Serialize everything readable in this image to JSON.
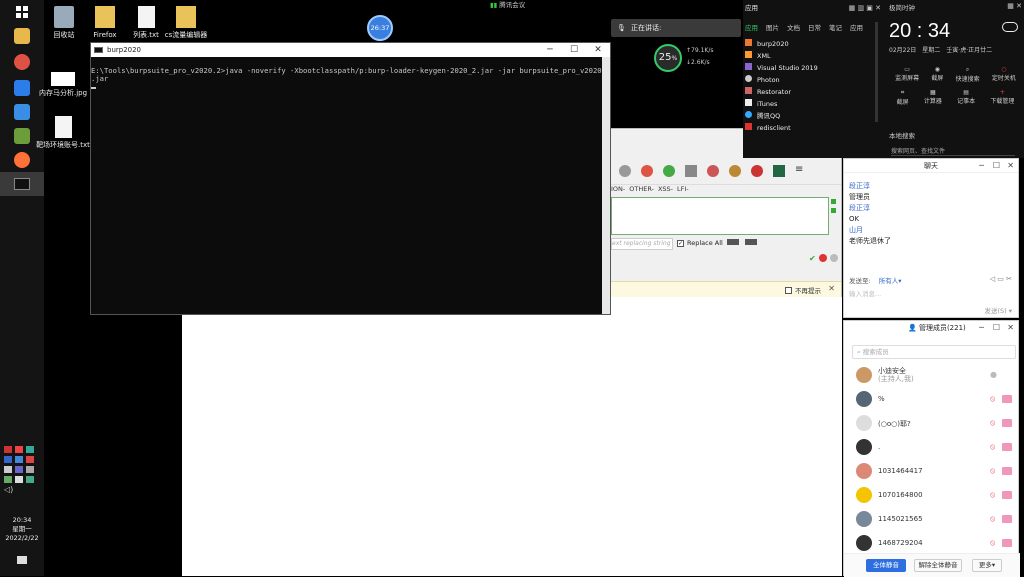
{
  "taskbar": {
    "clock_time": "20:34",
    "clock_day": "星期一",
    "clock_date": "2022/2/22"
  },
  "desktop": {
    "icons": [
      {
        "label": "回收站",
        "icon": "recycle-bin-icon"
      },
      {
        "label": "Firefox",
        "icon": "folder-icon"
      },
      {
        "label": "列表.txt",
        "icon": "text-file-icon"
      },
      {
        "label": "cs流量编辑器",
        "icon": "folder-icon"
      },
      {
        "label": "内存马分析.jpg",
        "icon": "image-file-icon"
      },
      {
        "label": "靶场环境账号.txt",
        "icon": "text-file-icon"
      }
    ],
    "timer_badge": "26:37"
  },
  "meeting_bar": {
    "label": "腾讯会议"
  },
  "cmd_window": {
    "title": "burp2020",
    "command_line": "E:\\Tools\\burpsuite_pro_v2020.2>java -noverify -Xbootclasspath/p:burp-loader-keygen-2020_2.jar -jar burpsuite_pro_v2020.2",
    "command_cont": ".jar"
  },
  "speech_widget": {
    "label": "正在讲话:"
  },
  "net_widget": {
    "percent": "25",
    "percent_unit": "%",
    "up": "79.1K/s",
    "down": "2.6K/s"
  },
  "hackbar": {
    "menu": [
      "ION-",
      "OTHER-",
      "XSS-",
      "LFI-"
    ],
    "replace_placeholder": "ext replacing string",
    "replace_all_label": "Replace All",
    "no_prompt_label": "不再提示"
  },
  "launcher": {
    "header_title": "应用",
    "tabs": [
      "应用",
      "图片",
      "文档",
      "日常",
      "笔记",
      "应用"
    ],
    "items": [
      "burp2020",
      "XML",
      "Visual Studio 2019",
      "Photon",
      "Restorator",
      "iTunes",
      "腾讯QQ",
      "redisclient"
    ],
    "bottom_left": "本地搜索",
    "search_placeholder": "搜索网页、查找文件"
  },
  "clock_widget": {
    "title": "极简时钟",
    "time": "20 : 34",
    "date": "02月22日",
    "weekday": "星期二",
    "lunar": "壬寅·虎·正月廿二",
    "tools_row1": [
      "监测屏幕",
      "截屏",
      "快速搜索",
      "定时关机"
    ],
    "tools_row2": [
      "截屏",
      "计算器",
      "记事本",
      "下载管理"
    ]
  },
  "chat_window": {
    "title": "聊天",
    "messages": [
      {
        "text": "段正淳",
        "kind": "name"
      },
      {
        "text": "管理员",
        "kind": "msg"
      },
      {
        "text": "段正淳",
        "kind": "name"
      },
      {
        "text": "OK",
        "kind": "msg"
      },
      {
        "text": "山月",
        "kind": "name"
      },
      {
        "text": "老师先退休了",
        "kind": "msg"
      }
    ],
    "send_to_label": "发送至:",
    "send_to_value": "所有人",
    "input_placeholder": "输入消息...",
    "send_button": "发送(S)"
  },
  "members_window": {
    "title": "管理成员(221)",
    "search_placeholder": "搜索成员",
    "members": [
      {
        "name": "小迪安全",
        "sub": "(主持人,我)",
        "color": "#c96"
      },
      {
        "name": "%",
        "sub": "",
        "color": "#567"
      },
      {
        "name": "(○o○)耶?",
        "sub": "",
        "color": "#ddd"
      },
      {
        "name": ".",
        "sub": "",
        "color": "#333"
      },
      {
        "name": "1031464417",
        "sub": "",
        "color": "#d87"
      },
      {
        "name": "1070164800",
        "sub": "",
        "color": "#f4c400"
      },
      {
        "name": "1145021565",
        "sub": "",
        "color": "#789"
      },
      {
        "name": "1468729204",
        "sub": "",
        "color": "#333"
      }
    ],
    "mute_all_button": "全体静音",
    "unmute_all_button": "解除全体静音",
    "more_button": "更多"
  }
}
